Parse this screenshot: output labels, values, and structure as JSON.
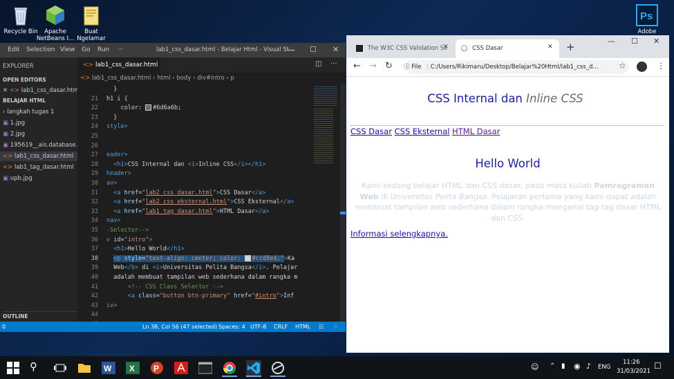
{
  "desktop": {
    "icons": [
      {
        "label": "Recycle Bin"
      },
      {
        "label": "Apache NetBeans I..."
      },
      {
        "label": "Buat Ngelamar"
      },
      {
        "label": "Adobe"
      }
    ]
  },
  "vscode": {
    "menu": [
      "Edit",
      "Selection",
      "View",
      "Go",
      "Run",
      "···"
    ],
    "title": "lab1_css_dasar.html - Belajar Html - Visual St...",
    "explorer_label": "EXPLORER",
    "explorer_more": "···",
    "open_editors_label": "OPEN EDITORS",
    "open_editor_file": "lab1_css_dasar.html",
    "folder_label": "BELAJAR HTML",
    "files": [
      {
        "name": "langkah tugas 1",
        "type": "folder"
      },
      {
        "name": "1.jpg",
        "type": "image"
      },
      {
        "name": "2.jpg",
        "type": "image"
      },
      {
        "name": "195619__ais.database....",
        "type": "image"
      },
      {
        "name": "lab1_css_dasar.html",
        "type": "html"
      },
      {
        "name": "lab1_tag_dasar.html",
        "type": "html"
      },
      {
        "name": "upb.jpg",
        "type": "image"
      }
    ],
    "outline_label": "OUTLINE",
    "tab_label": "lab1_css_dasar.html",
    "breadcrumb": [
      "lab1_css_dasar.html",
      "html",
      "body",
      "div#intro",
      "p"
    ],
    "code_lines": [
      {
        "n": "",
        "html": "  }"
      },
      {
        "n": "21",
        "html": "h1 i {"
      },
      {
        "n": "22",
        "html": "    color: <span class=\"sw\" style=\"background:#6d6a6b\"></span>#6d6a6b;"
      },
      {
        "n": "23",
        "html": "  }"
      },
      {
        "n": "24",
        "html": "<span class=\"tok-tag\">style&gt;</span>"
      },
      {
        "n": "25",
        "html": ""
      },
      {
        "n": "26",
        "html": ""
      },
      {
        "n": "27",
        "html": "<span class=\"tok-tag\">eader&gt;</span>"
      },
      {
        "n": "28",
        "html": "  <span class=\"tok-tag\">&lt;h1&gt;</span>CSS Internal dan <span class=\"tok-tag\">&lt;i&gt;</span>Inline CSS<span class=\"tok-tag\">&lt;/i&gt;&lt;/h1&gt;</span>"
      },
      {
        "n": "29",
        "html": "<span class=\"tok-tag\">header&gt;</span>"
      },
      {
        "n": "30",
        "html": "<span class=\"tok-tag\">av&gt;</span>"
      },
      {
        "n": "31",
        "html": "  <span class=\"tok-tag\">&lt;a</span> <span class=\"tok-attr\">href</span>=<span class=\"tok-str\">\"<u>lab2_css_dasar.html</u>\"</span><span class=\"tok-tag\">&gt;</span>CSS Dasar<span class=\"tok-tag\">&lt;/a&gt;</span>"
      },
      {
        "n": "32",
        "html": "  <span class=\"tok-tag\">&lt;a</span> <span class=\"tok-attr\">href</span>=<span class=\"tok-str\">\"<u>lab2_css_eksternal.html</u>\"</span><span class=\"tok-tag\">&gt;</span>CSS Eksternal<span class=\"tok-tag\">&lt;/a&gt;</span>"
      },
      {
        "n": "33",
        "html": "  <span class=\"tok-tag\">&lt;a</span> <span class=\"tok-attr\">href</span>=<span class=\"tok-str\">\"<u>lab1_tag_dasar.html</u>\"</span><span class=\"tok-tag\">&gt;</span>HTML Dasar<span class=\"tok-tag\">&lt;/a&gt;</span>"
      },
      {
        "n": "34",
        "html": "<span class=\"tok-tag\">nav&gt;</span>"
      },
      {
        "n": "35",
        "html": "<span class=\"tok-com\">-Selector--&gt;</span>"
      },
      {
        "n": "36",
        "html": "<span class=\"tok-tag\">v</span> <span class=\"tok-attr\">id</span>=<span class=\"tok-str\">\"intro\"</span><span class=\"tok-tag\">&gt;</span>"
      },
      {
        "n": "37",
        "html": "  <span class=\"tok-tag\">&lt;h1&gt;</span>Hello World<span class=\"tok-tag\">&lt;/h1&gt;</span>"
      },
      {
        "n": "38",
        "html": "  <span class=\"hl\"><span class=\"tok-tag\">&lt;p</span> <span class=\"tok-attr\">style</span>=<span class=\"tok-str\">\"text-align: center; color: <span class=\"sw\" style=\"background:#ccd8e4\"></span>#ccd8e4;\"</span></span><span class=\"tok-tag\">&gt;</span>Ka"
      },
      {
        "n": "39",
        "html": "  Web<span class=\"tok-tag\">&lt;/b&gt;</span> di <span class=\"tok-tag\">&lt;i&gt;</span>Universitas Pelita Bangsa<span class=\"tok-tag\">&lt;/i&gt;</span>. Pelajar"
      },
      {
        "n": "40",
        "html": "  adalah membuat tampilan web sederhana dalam rangka m"
      },
      {
        "n": "41",
        "html": "      <span class=\"tok-com\">&lt;!-- CSS Class Selector --&gt;</span>"
      },
      {
        "n": "42",
        "html": "      <span class=\"tok-tag\">&lt;a</span> <span class=\"tok-attr\">class</span>=<span class=\"tok-str\">\"button btn-primary\"</span> <span class=\"tok-attr\">href</span>=<span class=\"tok-str\">\"<u>#intro</u>\"</span><span class=\"tok-tag\">&gt;</span>Inf"
      },
      {
        "n": "43",
        "html": "<span class=\"tok-tag\">iv&gt;</span>"
      },
      {
        "n": "44",
        "html": ""
      },
      {
        "n": "45",
        "html": ""
      }
    ],
    "status": {
      "left": "0",
      "position": "Ln 38, Col 56 (47 selected)",
      "spaces": "Spaces: 4",
      "encoding": "UTF-8",
      "eol": "CRLF",
      "language": "HTML"
    }
  },
  "chrome": {
    "tabs": [
      {
        "title": "The W3C CSS Validation Se"
      },
      {
        "title": "CSS Dasar"
      }
    ],
    "new_tab": "+",
    "url_prefix": "File",
    "url": "C:/Users/Rikimaru/Desktop/Belajar%20Html/lab1_css_d...",
    "page": {
      "h1_plain": "CSS Internal dan ",
      "h1_italic": "Inline CSS",
      "nav_links": [
        "CSS Dasar",
        "CSS Eksternal",
        "HTML Dasar"
      ],
      "intro_heading": "Hello World",
      "para_1": "Kami sedang belajar HTML dan CSS dasar, pada mata kuliah ",
      "para_bold": "Pemrograman Web",
      "para_2": " di ",
      "para_italic": "Universitas Pelita Bangsa",
      "para_3": ". Pelajaran pertama yang kami dapat adalah membuat tampilan web sederhana dalam rangka mengenal tag-tag dasar HTML dan CSS.",
      "more_link": "Informasi selengkapnya."
    }
  },
  "taskbar": {
    "lang": "ENG",
    "time": "11:26",
    "date": "31/03/2021"
  },
  "colors": {
    "vscode_status": "#007acc",
    "page_heading": "#1f1f9a",
    "para_text": "#ccd8e4",
    "chrome_tabbar": "#dee1e6"
  }
}
